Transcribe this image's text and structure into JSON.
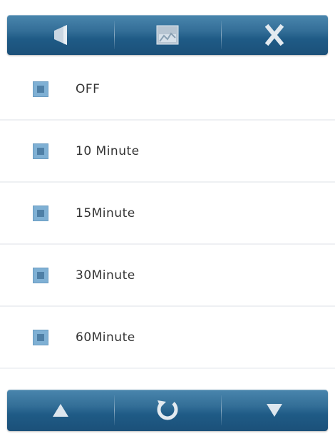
{
  "toolbar": {
    "buttons": [
      {
        "name": "back",
        "icon": "back-arrow-icon"
      },
      {
        "name": "home",
        "icon": "home-icon"
      },
      {
        "name": "close",
        "icon": "close-icon"
      }
    ]
  },
  "options": [
    {
      "label": "OFF"
    },
    {
      "label": "10 Minute"
    },
    {
      "label": "15Minute"
    },
    {
      "label": "30Minute"
    },
    {
      "label": "60Minute"
    }
  ],
  "bottom_bar": {
    "buttons": [
      {
        "name": "up",
        "icon": "up-arrow-icon"
      },
      {
        "name": "refresh",
        "icon": "refresh-icon"
      },
      {
        "name": "down",
        "icon": "down-arrow-icon"
      }
    ]
  },
  "colors": {
    "bar_gradient_top": "#4a86ad",
    "bar_gradient_bottom": "#1b5079",
    "checkbox_fill": "#7fb0d4",
    "checkbox_inner": "#4e7fa6",
    "row_divider": "#eef0f3"
  }
}
